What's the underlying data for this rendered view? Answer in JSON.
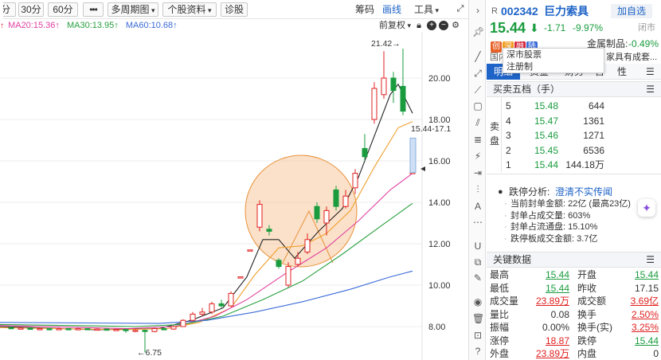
{
  "toolbar": {
    "period_partial": "分",
    "btn_30": "30分",
    "btn_60": "60分",
    "btn_more": "•••",
    "multi_period": "多周期图",
    "stock_info": "个股资料",
    "diagnose": "诊股",
    "chip": "筹码",
    "draw": "画线",
    "tools": "工具"
  },
  "ma": {
    "ma20": "MA20:15.36↑",
    "ma30": "MA30:13.95↑",
    "ma60": "MA60:10.68↑",
    "colors": {
      "ma5": "#222222",
      "ma10": "#f0a030",
      "ma20": "#e040a0",
      "ma30": "#2aa040",
      "ma60": "#3a6ad8"
    }
  },
  "chart": {
    "restore": "前复权",
    "high_label": "21.42→",
    "low_label": "←6.75",
    "range_label": "15.44-17.1",
    "y_ticks": [
      "20.00",
      "18.00",
      "16.00",
      "14.00",
      "12.00",
      "10.00",
      "8.00"
    ],
    "up_color": "#e02020",
    "down_color": "#1a9c3e"
  },
  "quote": {
    "prefix": "R",
    "code": "002342",
    "name": "巨力索具",
    "add_btn": "加自选",
    "price": "15.44",
    "change": "-1.71",
    "pct": "-9.97%",
    "status": "闭市",
    "tags": [
      {
        "t": "创",
        "c": "#e8632a"
      },
      {
        "t": "深",
        "c": "#f29c1f"
      },
      {
        "t": "融",
        "c": "#d6223a"
      },
      {
        "t": "陆",
        "c": "#3a6ad8"
      }
    ],
    "sector": "金属制品:",
    "sector_pct": "-0.49%",
    "tooltip_line1": "深市股票",
    "tooltip_line2": "注册制",
    "info_left": "国内",
    "info_right": "家具有成套...",
    "tabs": [
      "明细",
      "资金",
      "财务",
      "盘口",
      "分时"
    ],
    "tab_more": "性"
  },
  "order_book": {
    "title": "买卖五档（手）",
    "side_label": "卖盘",
    "rows": [
      {
        "lvl": "5",
        "price": "15.48",
        "vol": "644"
      },
      {
        "lvl": "4",
        "price": "15.47",
        "vol": "1361"
      },
      {
        "lvl": "3",
        "price": "15.46",
        "vol": "1271"
      },
      {
        "lvl": "2",
        "price": "15.45",
        "vol": "6536"
      },
      {
        "lvl": "1",
        "price": "15.44",
        "vol": "144.18万"
      }
    ]
  },
  "analysis": {
    "title": "跌停分析:",
    "link": "澄清不实传闻",
    "items": [
      "当前封单金额: 22亿 (最高23亿)",
      "封单占成交量: 603%",
      "封单占流通盘: 15.10%",
      "跌停板成交金额: 3.7亿"
    ]
  },
  "key_data": {
    "title": "关键数据",
    "rows": [
      {
        "l1": "最高",
        "v1": "15.44",
        "l2": "开盘",
        "v2": "15.44"
      },
      {
        "l1": "最低",
        "v1": "15.44",
        "l2": "昨收",
        "v2": "17.15"
      },
      {
        "l1": "成交量",
        "v1": "23.89万",
        "l2": "成交额",
        "v2": "3.69亿"
      },
      {
        "l1": "量比",
        "v1": "0.08",
        "l2": "换手",
        "v2": "2.50%"
      },
      {
        "l1": "振幅",
        "v1": "0.00%",
        "l2": "换手(实)",
        "v2": "3.25%"
      },
      {
        "l1": "涨停",
        "v1": "18.87",
        "l2": "跌停",
        "v2": "15.44"
      },
      {
        "l1": "外盘",
        "v1": "23.89万",
        "l2": "内盘",
        "v2": "0"
      }
    ]
  }
}
